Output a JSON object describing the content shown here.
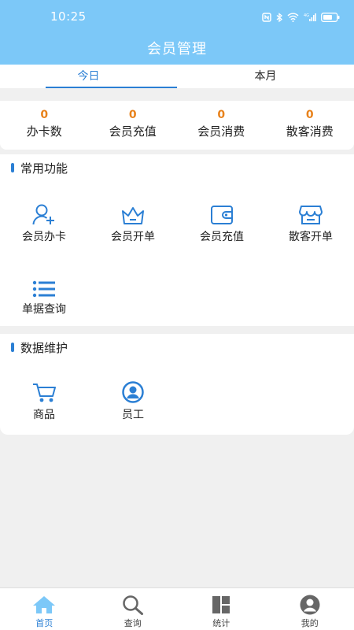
{
  "status_bar": {
    "time": "10:25"
  },
  "header": {
    "title": "会员管理"
  },
  "tabs": [
    {
      "label": "今日",
      "active": true
    },
    {
      "label": "本月",
      "active": false
    }
  ],
  "stats": [
    {
      "value": "0",
      "label": "办卡数"
    },
    {
      "value": "0",
      "label": "会员充值"
    },
    {
      "value": "0",
      "label": "会员消费"
    },
    {
      "value": "0",
      "label": "散客消费"
    }
  ],
  "common": {
    "title": "常用功能",
    "items": [
      {
        "label": "会员办卡",
        "icon": "user-add-icon"
      },
      {
        "label": "会员开单",
        "icon": "crown-icon"
      },
      {
        "label": "会员充值",
        "icon": "wallet-icon"
      },
      {
        "label": "散客开单",
        "icon": "store-icon"
      },
      {
        "label": "单据查询",
        "icon": "list-icon"
      }
    ]
  },
  "data_maintenance": {
    "title": "数据维护",
    "items": [
      {
        "label": "商品",
        "icon": "cart-icon"
      },
      {
        "label": "员工",
        "icon": "employee-icon"
      }
    ]
  },
  "bottom_nav": [
    {
      "label": "首页",
      "icon": "home-icon",
      "active": true
    },
    {
      "label": "查询",
      "icon": "search-icon",
      "active": false
    },
    {
      "label": "统计",
      "icon": "stats-icon",
      "active": false
    },
    {
      "label": "我的",
      "icon": "profile-icon",
      "active": false
    }
  ],
  "colors": {
    "header": "#7cc8f8",
    "accent": "#2b7fd4",
    "stat_value": "#e8821b"
  }
}
